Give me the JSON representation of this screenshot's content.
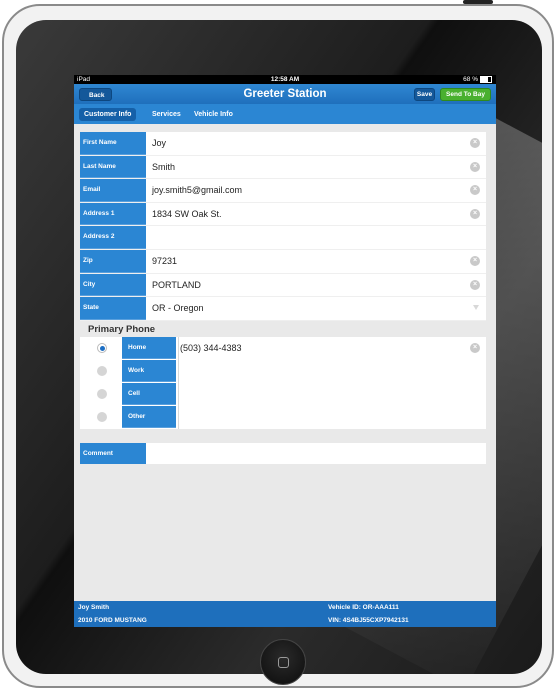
{
  "status_bar": {
    "carrier": "iPad",
    "time": "12:58 AM",
    "battery": "68 %"
  },
  "nav": {
    "back_label": "Back",
    "title": "Greeter Station",
    "save_label": "Save",
    "send_to_bay_label": "Send To Bay"
  },
  "tabs": [
    {
      "label": "Customer Info",
      "active": true
    },
    {
      "label": "Services",
      "active": false
    },
    {
      "label": "Vehicle Info",
      "active": false
    }
  ],
  "customer_fields": [
    {
      "label": "First Name",
      "value": "Joy"
    },
    {
      "label": "Last Name",
      "value": "Smith"
    },
    {
      "label": "Email",
      "value": "joy.smith5@gmail.com"
    },
    {
      "label": "Address 1",
      "value": "1834 SW Oak St."
    },
    {
      "label": "Address 2",
      "value": ""
    },
    {
      "label": "Zip",
      "value": "97231"
    },
    {
      "label": "City",
      "value": "PORTLAND"
    },
    {
      "label": "State",
      "value": "OR - Oregon"
    }
  ],
  "primary_phone": {
    "title": "Primary Phone",
    "options": [
      {
        "label": "Home",
        "value": "(503) 344-4383",
        "selected": true
      },
      {
        "label": "Work",
        "value": "",
        "selected": false
      },
      {
        "label": "Cell",
        "value": "",
        "selected": false
      },
      {
        "label": "Other",
        "value": "",
        "selected": false
      }
    ]
  },
  "comment": {
    "label": "Comment",
    "value": ""
  },
  "footer": {
    "customer_name": "Joy Smith",
    "vehicle": "2010 FORD MUSTANG",
    "vehicle_id": "Vehicle ID: OR-AAA111",
    "vin": "VIN: 4S4BJ55CXP7942131"
  },
  "colors": {
    "primary_blue": "#2b86d3",
    "dark_blue": "#1560a8",
    "green": "#49b02f"
  }
}
